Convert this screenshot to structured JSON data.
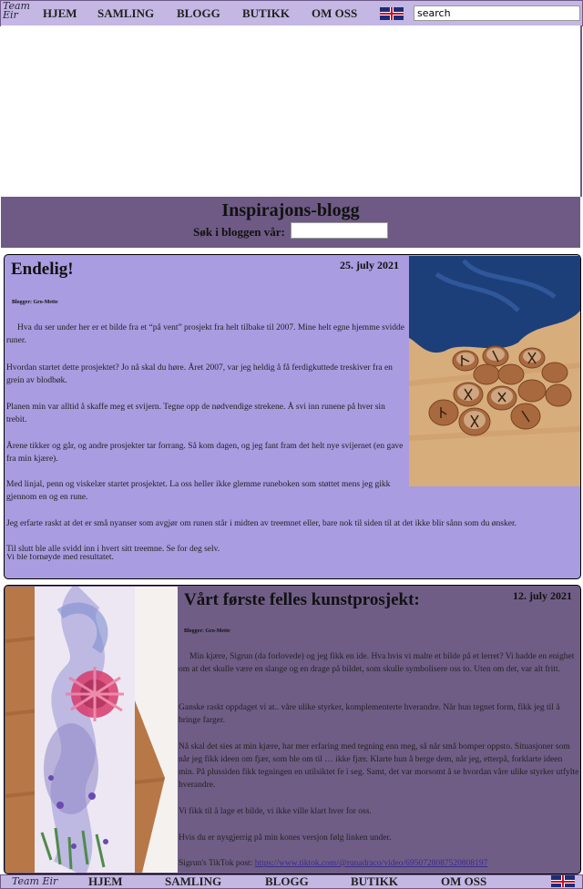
{
  "nav": {
    "logo": "Team Eir",
    "items": [
      "HJEM",
      "SAMLING",
      "BLOGG",
      "BUTIKK",
      "OM OSS"
    ],
    "search_value": "search"
  },
  "banner": {
    "title": "Inspirajons-blogg",
    "search_label": "Søk i bloggen vår:"
  },
  "posts": [
    {
      "title": "Endelig!",
      "date": "25. july 2021",
      "blogger": "Blogger: Gro-Mette",
      "paragraphs": [
        "Hva du ser under her er et bilde fra et “på vent” prosjekt fra helt tilbake til 2007. Mine helt egne hjemme svidde runer.",
        "Hvordan startet dette prosjektet? Jo nå skal du høre. Året 2007, var jeg heldig å få ferdigkuttede treskiver fra en grein av blodbøk.",
        "Planen min var alltid å skaffe meg et svijern. Tegne opp de nødvendige strekene. Å svi inn runene på hver sin trebit.",
        "Årene tikker og går, og andre prosjekter tar forrang. Så kom dagen, og jeg fant fram det helt nye svijernet (en gave fra min kjære).",
        "Med linjal, penn og viskelær startet prosjektet. La oss heller ikke glemme runeboken som støttet mens jeg gikk gjennom en og en rune.",
        "Jeg erfarte raskt at det er små nyanser som avgjør om runen står i midten av treemnet eller, bare nok til siden til at det ikke blir sånn som du ønsker.",
        "Til slutt ble alle svidd inn i hvert sitt treemne. Se for deg selv.",
        "Vi ble fornøyde med resultatet."
      ]
    },
    {
      "title": "Vårt første felles kunstprosjekt:",
      "date": "12. july 2021",
      "blogger": "Blogger: Gro-Mette",
      "paragraphs": [
        "Min kjære, Sigrun (da forlovede) og jeg fikk en ide. Hva hvis vi malte et bilde på et lerret? Vi hadde en enighet om at det skulle være en slange og en drage på bildet, som skulle symbolisere oss to. Uten om det, var alt fritt.",
        "Ganske raskt oppdaget vi at.. våre ulike styrker, komplementerte hverandre. Når hun tegnet form, fikk jeg til å bringe farger.",
        "Nå skal det sies at min kjære, har mer erfaring med tegning enn meg, så når små bomper oppsto. Situasjoner som når jeg fikk ideen om fjær, som ble om til … ikke fjær. Klarte hun å berge dem, når jeg, etterpå, forklarte ideen min. På plussiden fikk tegningen en utilsiktet fe i seg. Samt, det var morsomt å se hvordan våre ulike styrker utfylte hverandre.",
        "Vi fikk til å lage et bilde, vi ikke ville klart hver for oss.",
        "Hvis du er nysgjerrig på min kones versjon følg linken under."
      ],
      "tiktok_label": "Sigrun's TikTok post: ",
      "tiktok_link": "https://www.tiktok.com/@runadraco/video/6950728087520808197"
    }
  ],
  "footer": {
    "logo": "Team Eir",
    "items": [
      "HJEM",
      "SAMLING",
      "BLOGG",
      "BUTIKK",
      "OM OSS"
    ]
  },
  "colors": {
    "nav_bg": "#c4b7e3",
    "banner_bg": "#6e5a84",
    "post1_bg": "#a99ce0",
    "post2_bg": "#6f5d86"
  }
}
